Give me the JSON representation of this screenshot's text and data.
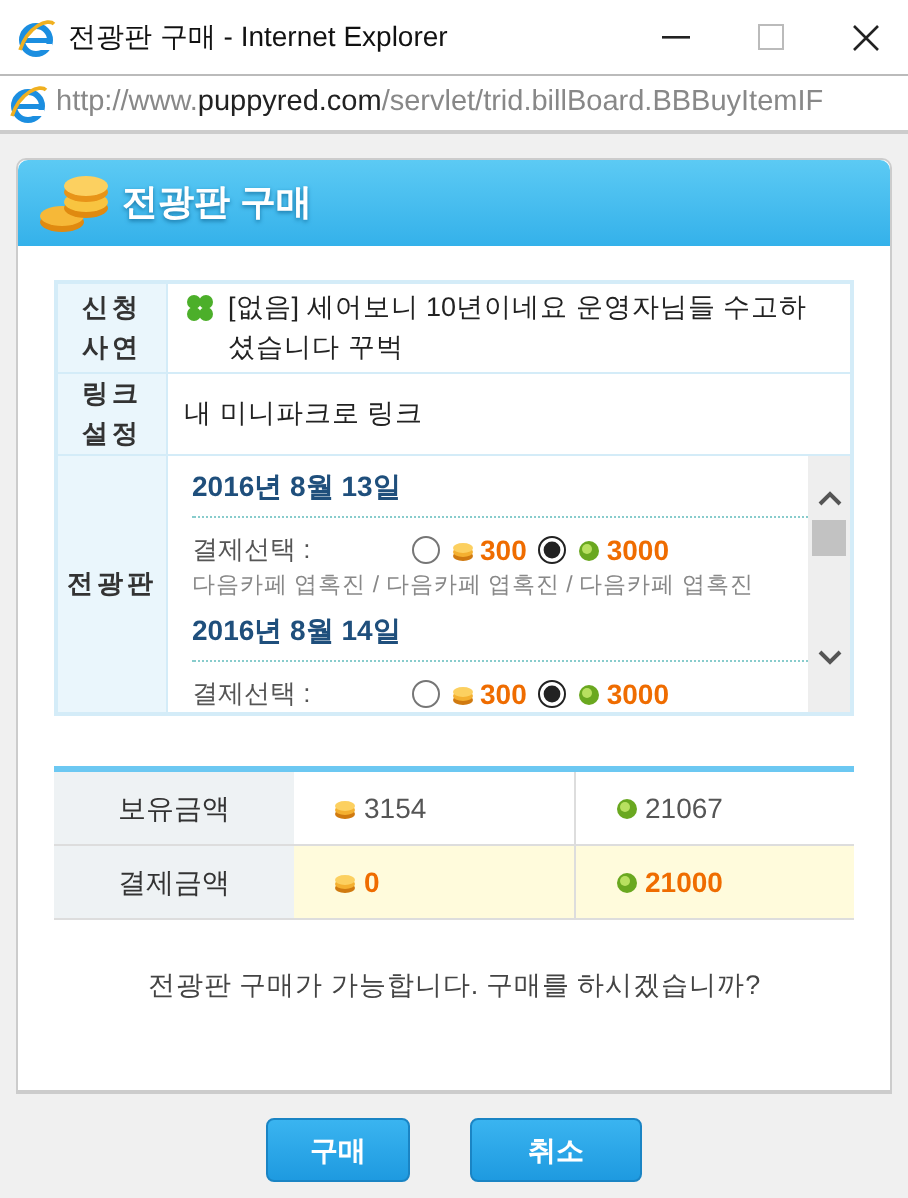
{
  "window": {
    "title": "전광판 구매 - Internet Explorer"
  },
  "address": {
    "scheme": "http://www.",
    "domain": "puppyred.com",
    "path": "/servlet/trid.billBoard.BBBuyItemIF"
  },
  "dialog": {
    "title": "전광판 구매"
  },
  "form_rows": [
    {
      "label": "신청 사연",
      "value": "[없음] 세어보니 10년이네요 운영자님들 수고하셨습니다 꾸벅"
    },
    {
      "label": "링크 설정",
      "value": "내 미니파크로 링크"
    }
  ],
  "billboard": {
    "label": "전광판",
    "entries": [
      {
        "date": "2016년 8월 13일",
        "payment_label": "결제선택 :",
        "options": [
          {
            "kind": "coin",
            "amount": "300",
            "selected": false
          },
          {
            "kind": "gem",
            "amount": "3000",
            "selected": true
          }
        ],
        "note": "다음카페 엽혹진 / 다음카페 엽혹진 / 다음카페 엽혹진"
      },
      {
        "date": "2016년 8월 14일",
        "payment_label": "결제선택 :",
        "options": [
          {
            "kind": "coin",
            "amount": "300",
            "selected": false
          },
          {
            "kind": "gem",
            "amount": "3000",
            "selected": true
          }
        ]
      }
    ]
  },
  "balances": [
    {
      "kind": "held",
      "label": "보유금액",
      "coin": "3154",
      "gem": "21067"
    },
    {
      "kind": "payment",
      "label": "결제금액",
      "coin": "0",
      "gem": "21000"
    }
  ],
  "message": "전광판 구매가 가능합니다. 구매를 하시겠습니까?",
  "buttons": [
    "구매",
    "취소"
  ]
}
